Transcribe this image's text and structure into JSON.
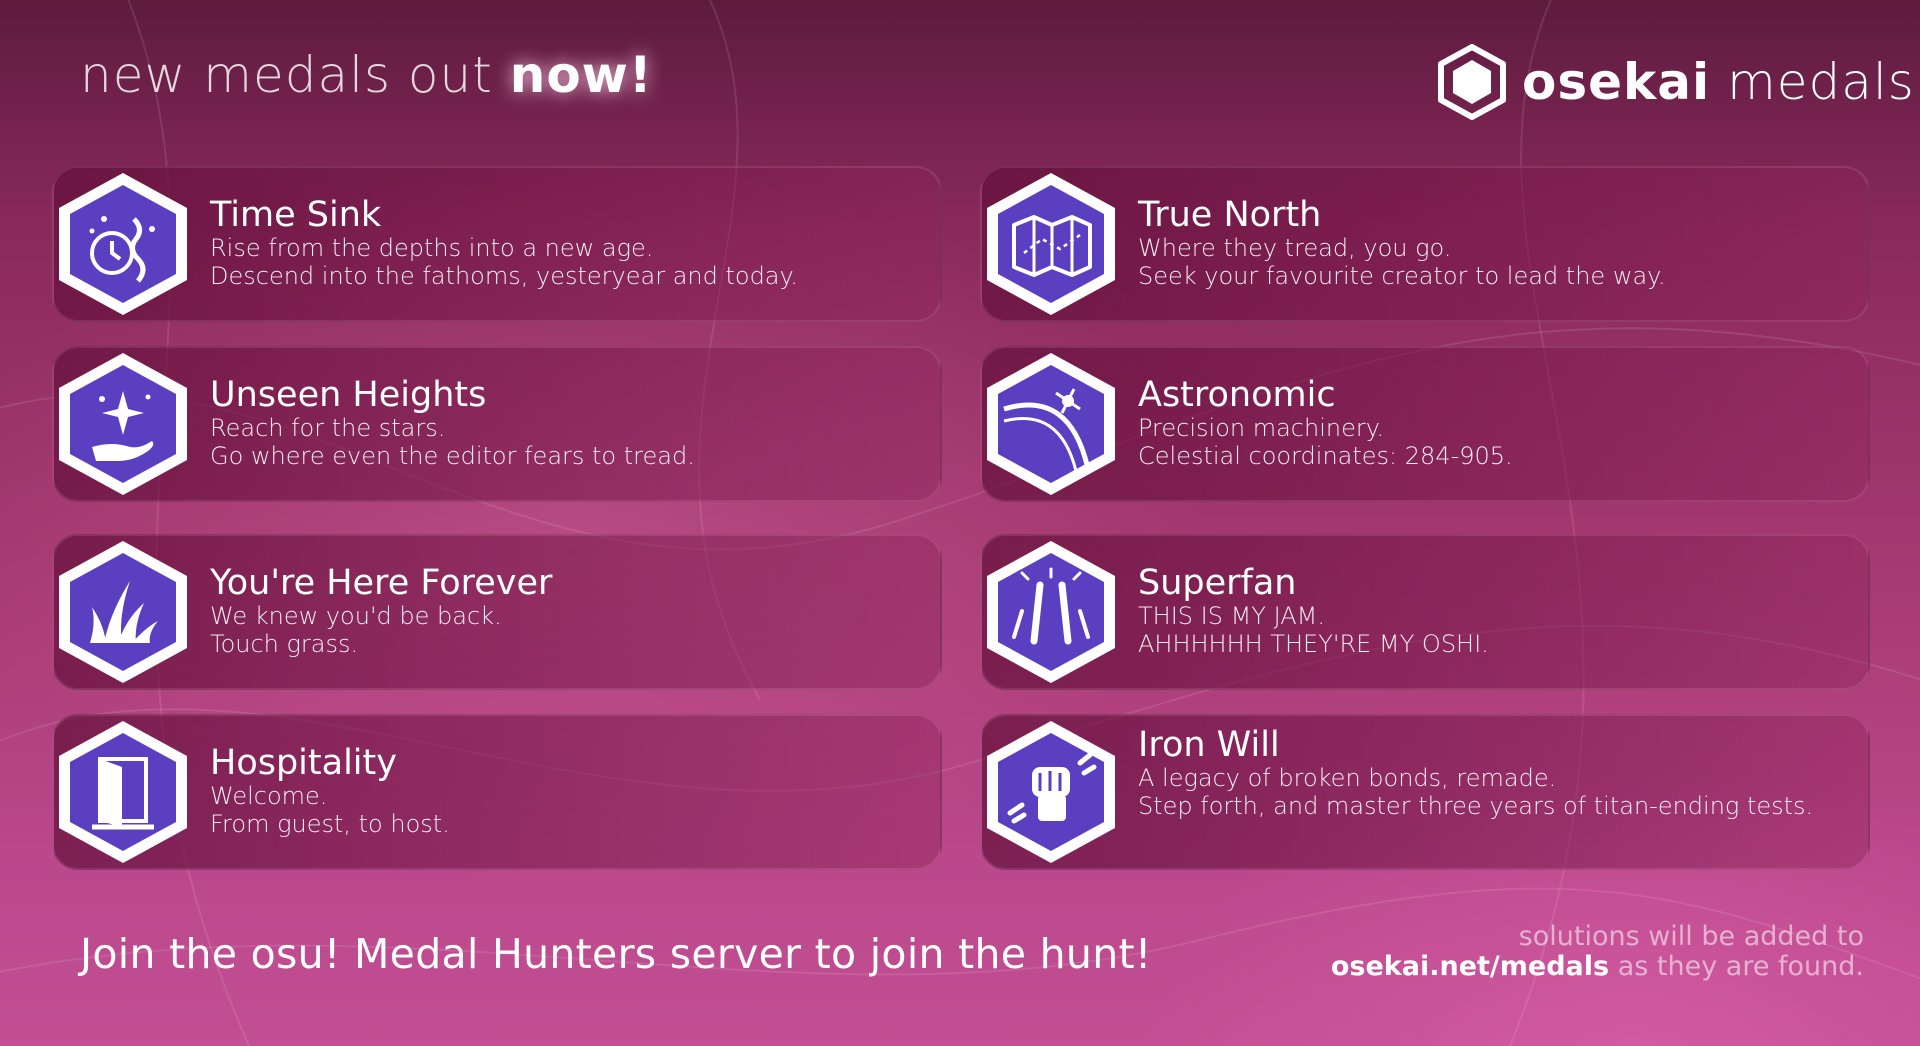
{
  "header": {
    "headline_prefix": "new medals out",
    "headline_emphasis": "now!",
    "brand_bold": "osekai",
    "brand_light": "medals"
  },
  "medals": [
    {
      "title": "Time Sink",
      "line1": "Rise from the depths into a new age.",
      "line2": "Descend into the fathoms, yesteryear and today.",
      "icon": "chained-clock-icon"
    },
    {
      "title": "True North",
      "line1": "Where they tread, you go.",
      "line2": "Seek your favourite creator to lead the way.",
      "icon": "map-icon"
    },
    {
      "title": "Unseen Heights",
      "line1": "Reach for the stars.",
      "line2": "Go where even the editor fears to tread.",
      "icon": "hand-sparkle-icon"
    },
    {
      "title": "Astronomic",
      "line1": "Precision machinery.",
      "line2": "Celestial coordinates: 284-905.",
      "icon": "satellite-orbit-icon"
    },
    {
      "title": "You're Here Forever",
      "line1": "We knew you'd be back.",
      "line2": "Touch grass.",
      "icon": "grass-icon"
    },
    {
      "title": "Superfan",
      "line1": "THIS IS MY JAM.",
      "line2": "AHHHHHH THEY'RE MY OSHI.",
      "icon": "glowsticks-icon"
    },
    {
      "title": "Hospitality",
      "line1": "Welcome.",
      "line2": "From guest, to host.",
      "icon": "open-door-icon"
    },
    {
      "title": "Iron Will",
      "line1": "A legacy of broken bonds, remade.",
      "line2": "Step forth, and master three years of titan-ending tests.",
      "icon": "fist-broken-chain-icon"
    }
  ],
  "footer": {
    "cta": "Join the osu! Medal Hunters server to join the hunt!",
    "note_line1": "solutions will be added to",
    "note_link": "osekai.net/medals",
    "note_suffix": "as they are found."
  },
  "colors": {
    "background_top": "#5d1b3e",
    "background_bottom": "#c24f93",
    "medal_purple": "#5a3fc0",
    "medal_rim": "#ffffff"
  }
}
